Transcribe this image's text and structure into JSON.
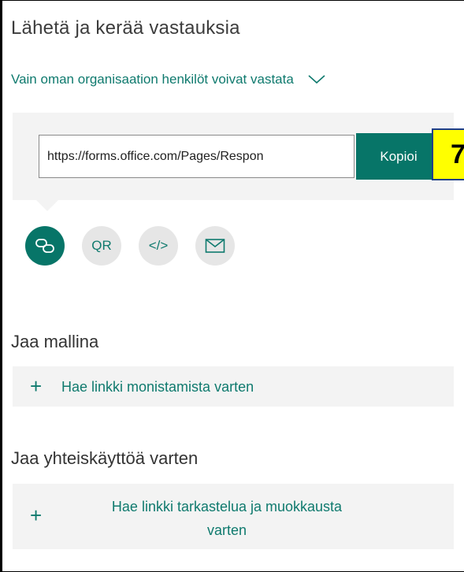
{
  "panel": {
    "title": "Lähetä ja kerää vastauksia",
    "audience_label": "Vain oman organisaation henkilöt voivat vastata"
  },
  "link": {
    "url": "https://forms.office.com/Pages/Respon",
    "copy_label": "Kopioi"
  },
  "callout": {
    "text": "7"
  },
  "share_options": [
    {
      "icon": "link-icon",
      "label": "",
      "selected": true
    },
    {
      "icon": "qr-code-icon",
      "label": "QR",
      "selected": false
    },
    {
      "icon": "embed-code-icon",
      "label": "</>",
      "selected": false
    },
    {
      "icon": "email-icon",
      "label": "",
      "selected": false
    }
  ],
  "template_section": {
    "title": "Jaa mallina",
    "action_label": "Hae linkki monistamista varten"
  },
  "collaborate_section": {
    "title": "Jaa yhteiskäyttöä varten",
    "action_line1": "Hae linkki tarkastelua ja muokkausta",
    "action_line2": "varten"
  },
  "colors": {
    "accent": "#077568",
    "link_text": "#0f7a6e",
    "panel_bg": "#f3f3f3",
    "callout_bg": "#ffff00"
  }
}
